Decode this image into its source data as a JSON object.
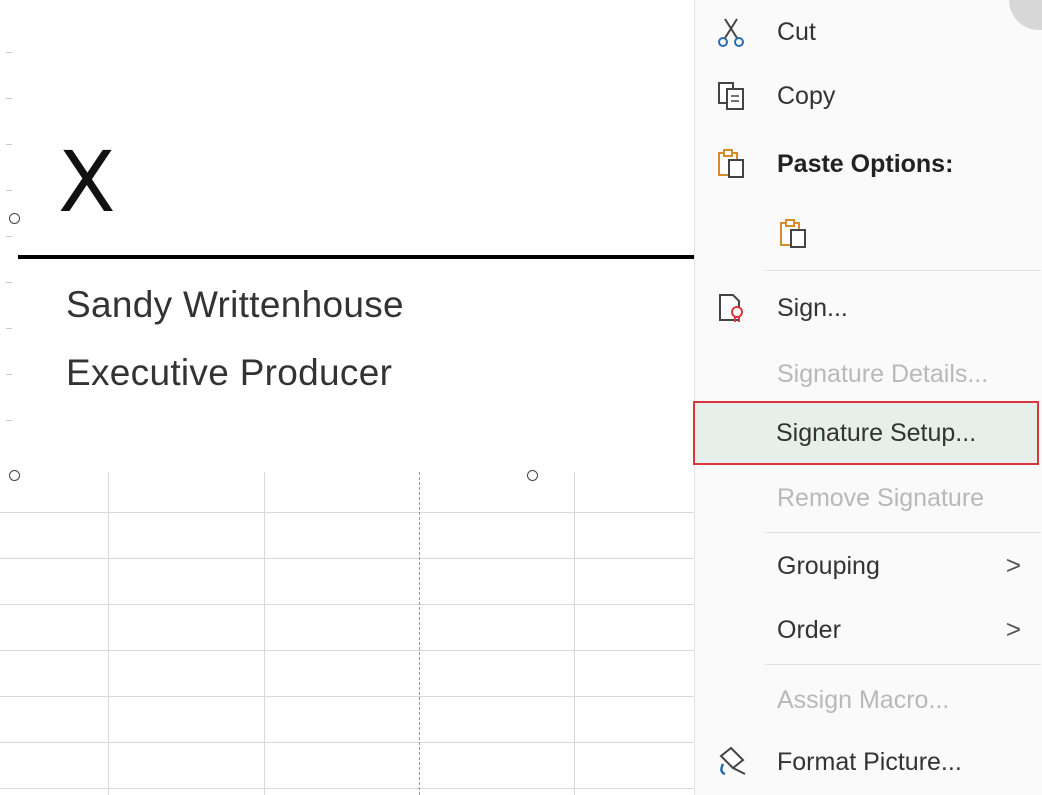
{
  "signature": {
    "x_mark": "X",
    "signer_name": "Sandy Writtenhouse",
    "signer_title": "Executive Producer"
  },
  "menu": {
    "cut": "Cut",
    "copy": "Copy",
    "paste_options": "Paste Options:",
    "sign": "Sign...",
    "signature_details": "Signature Details...",
    "signature_setup": "Signature Setup...",
    "remove_signature": "Remove Signature",
    "grouping": "Grouping",
    "order": "Order",
    "assign_macro": "Assign Macro...",
    "format_picture": "Format Picture...",
    "submenu_arrow": ">"
  },
  "colors": {
    "highlight_border": "#d9363e",
    "highlight_fill": "#e6efe9",
    "paste_icon": "#d88b2b"
  },
  "icons": [
    "scissors-icon",
    "copy-icon",
    "paste-icon",
    "paste-keep-format-icon",
    "sign-icon",
    "format-picture-icon"
  ]
}
